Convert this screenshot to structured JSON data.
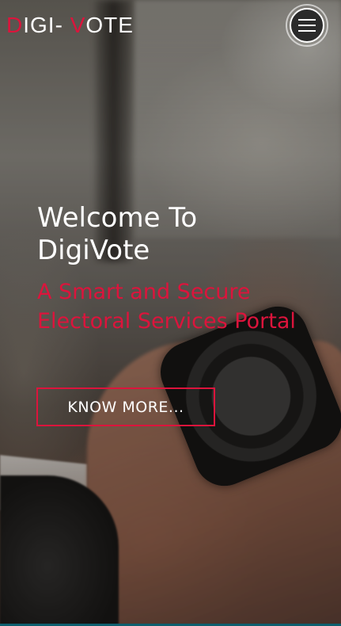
{
  "header": {
    "brand_part1_accent": "D",
    "brand_part1_rest": "IGI- ",
    "brand_part2_accent": "V",
    "brand_part2_rest": "OTE",
    "menu_icon": "hamburger-menu-icon"
  },
  "hero": {
    "title": "Welcome To DigiVote",
    "subtitle": "A Smart and Secure Electoral Services Portal",
    "cta_label": "KNOW MORE..."
  },
  "colors": {
    "accent": "#dc143c",
    "text": "#ffffff",
    "menu_button_bg": "#2b2b2b",
    "bottom_line": "#0d5f6e"
  }
}
